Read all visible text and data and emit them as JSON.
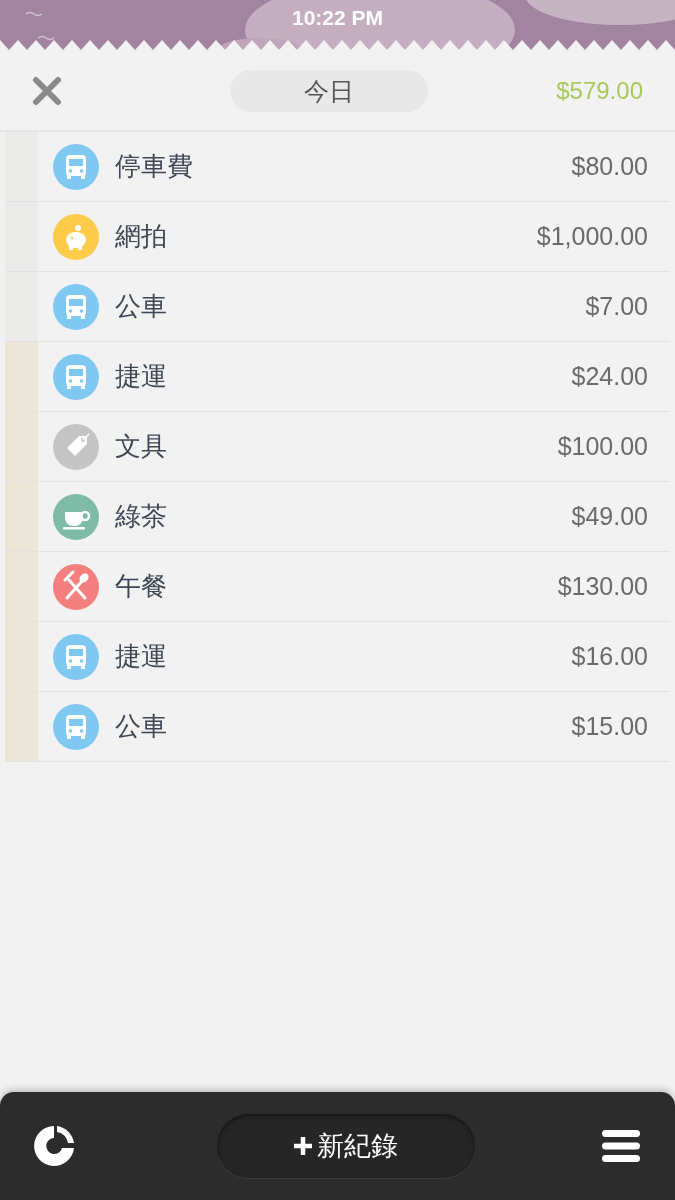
{
  "status_bar": {
    "time": "10:22 PM"
  },
  "header": {
    "title": "今日",
    "total": "$579.00"
  },
  "entries": [
    {
      "name": "停車費",
      "amount": "$80.00",
      "kind": "bus",
      "color": "#ebebe9"
    },
    {
      "name": "網拍",
      "amount": "$1,000.00",
      "kind": "piggy",
      "color": "#ebebe9"
    },
    {
      "name": "公車",
      "amount": "$7.00",
      "kind": "bus",
      "color": "#ebebe9"
    },
    {
      "name": "捷運",
      "amount": "$24.00",
      "kind": "bus",
      "color": "#ece6d8"
    },
    {
      "name": "文具",
      "amount": "$100.00",
      "kind": "tag",
      "color": "#ece6d8"
    },
    {
      "name": "綠茶",
      "amount": "$49.00",
      "kind": "cup",
      "color": "#ece6d8"
    },
    {
      "name": "午餐",
      "amount": "$130.00",
      "kind": "meal",
      "color": "#ece6d8"
    },
    {
      "name": "捷運",
      "amount": "$16.00",
      "kind": "bus",
      "color": "#ece6d8"
    },
    {
      "name": "公車",
      "amount": "$15.00",
      "kind": "bus",
      "color": "#ece6d8"
    }
  ],
  "toolbar": {
    "add_label": "新紀錄"
  }
}
